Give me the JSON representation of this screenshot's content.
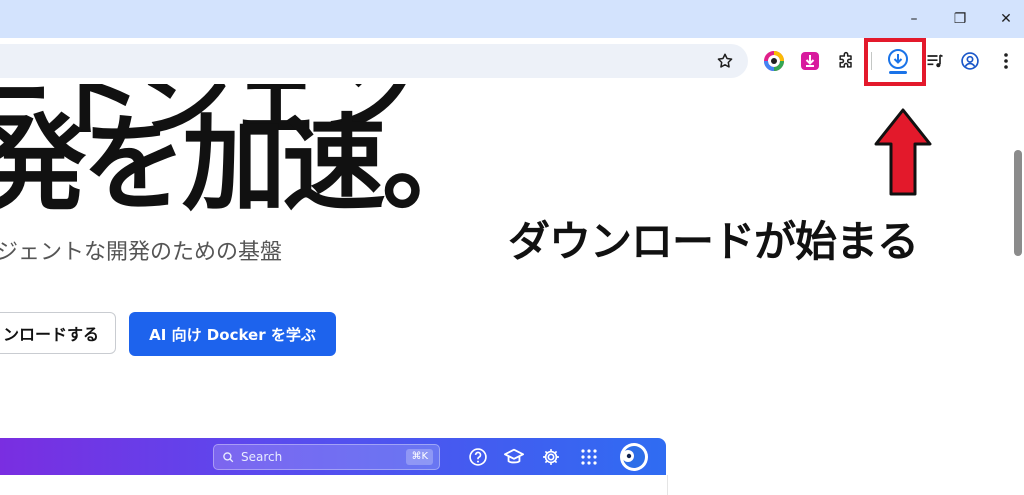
{
  "browser": {
    "window_controls": {
      "minimize": "–",
      "restore": "❐",
      "close": "✕"
    }
  },
  "hero": {
    "title_top_fragment": "ートシェン",
    "title": "発を加速。",
    "subtitle": "ジェントな開発のための基盤"
  },
  "buttons": {
    "download_label": "ンロードする",
    "learn_label": "AI 向け Docker を学ぶ"
  },
  "annotation": {
    "text": "ダウンロードが始まる",
    "arrow_color": "#e3192b",
    "box_color": "#e3192b"
  },
  "app_preview": {
    "search_placeholder": "Search",
    "search_shortcut": "⌘K"
  },
  "colors": {
    "accent": "#1d63ed",
    "titlebar": "#d3e3fd"
  }
}
